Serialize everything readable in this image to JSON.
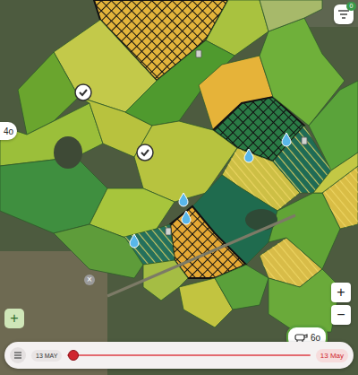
{
  "map": {
    "fields": [
      {
        "color": "#e3b43a",
        "kind": "grid"
      },
      {
        "color": "#a9c23f",
        "kind": "plain"
      },
      {
        "color": "#c3c94a",
        "kind": "plain"
      },
      {
        "color": "#6aa52e",
        "kind": "plain"
      },
      {
        "color": "#9bbf3a",
        "kind": "plain"
      },
      {
        "color": "#b8c23e",
        "kind": "plain"
      },
      {
        "color": "#4f9a2e",
        "kind": "plain"
      },
      {
        "color": "#e6b339",
        "kind": "plain"
      },
      {
        "color": "#2a7a45",
        "kind": "grid"
      },
      {
        "color": "#6fb03a",
        "kind": "plain"
      },
      {
        "color": "#a7b96a",
        "kind": "plain"
      },
      {
        "color": "#5aa33a",
        "kind": "plain"
      },
      {
        "color": "#3f8f3f",
        "kind": "plain"
      },
      {
        "color": "#b7c33f",
        "kind": "plain"
      },
      {
        "color": "#a7c53c",
        "kind": "plain"
      },
      {
        "color": "#cdbf45",
        "kind": "hatch"
      },
      {
        "color": "#1f6b55",
        "kind": "hatch"
      },
      {
        "color": "#d9bd45",
        "kind": "hatch"
      },
      {
        "color": "#1f6b4e",
        "kind": "plain"
      },
      {
        "color": "#e5a935",
        "kind": "grid"
      },
      {
        "color": "#24705c",
        "kind": "hatch"
      },
      {
        "color": "#d8bc48",
        "kind": "hatch"
      },
      {
        "color": "#61a436",
        "kind": "plain"
      },
      {
        "color": "#c2c440",
        "kind": "plain"
      },
      {
        "color": "#5aa03a",
        "kind": "plain"
      },
      {
        "color": "#6aaa3a",
        "kind": "plain"
      },
      {
        "color": "#5e9c3a",
        "kind": "plain"
      },
      {
        "color": "#a5bd44",
        "kind": "plain"
      },
      {
        "color": "#c3c845",
        "kind": "plain"
      }
    ]
  },
  "filter": {
    "badge": "0"
  },
  "herd_badges": [
    {
      "label": "4o"
    },
    {
      "label": "6o"
    }
  ],
  "zoom": {
    "in": "+",
    "out": "−"
  },
  "add_button": "+",
  "close_marker": "×",
  "timeline": {
    "start_label": "13 MAY",
    "end_label": "13 May",
    "level": 0.01,
    "playing": false
  }
}
